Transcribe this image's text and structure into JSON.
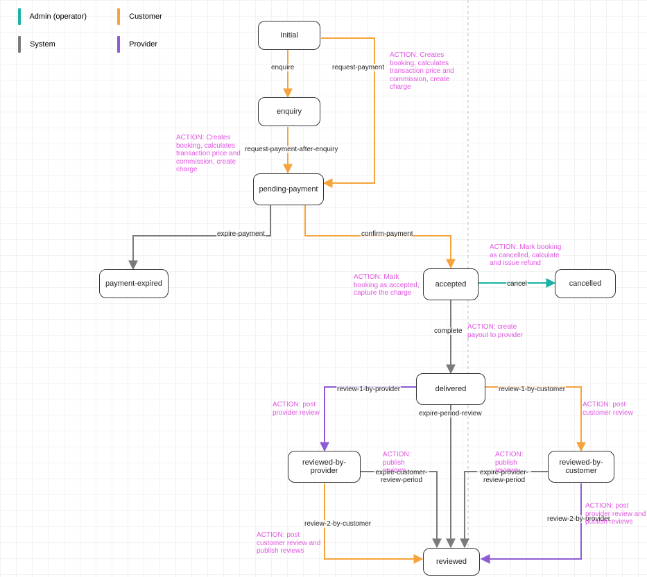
{
  "legend": {
    "admin": "Admin (operator)",
    "customer": "Customer",
    "system": "System",
    "provider": "Provider"
  },
  "colors": {
    "admin": "#18b3a6",
    "customer": "#f6a33b",
    "system": "#7a7a7a",
    "provider": "#8e5bd3",
    "action": "#e157e1"
  },
  "states": {
    "initial": "Initial",
    "enquiry": "enquiry",
    "pending_payment": "pending-payment",
    "payment_expired": "payment-expired",
    "accepted": "accepted",
    "cancelled": "cancelled",
    "delivered": "delivered",
    "reviewed_by_provider": "reviewed-by-provider",
    "reviewed_by_customer": "reviewed-by-customer",
    "reviewed": "reviewed"
  },
  "edges": {
    "enquire": "enquire",
    "request_payment": "request-payment",
    "request_payment_after_enquiry": "request-payment-after-enquiry",
    "expire_payment": "expire-payment",
    "confirm_payment": "confirm-payment",
    "cancel": "cancel",
    "complete": "complete",
    "review1_provider": "review-1-by-provider",
    "review1_customer": "review-1-by-customer",
    "expire_period_review": "expire-period-review",
    "expire_customer_review_period": "expire-customer-review-period",
    "expire_provider_review_period": "expire-provider-review-period",
    "review2_customer": "review-2-by-customer",
    "review2_provider": "review-2-by-provider"
  },
  "actions": {
    "creates_booking": "ACTION: Creates booking, calculates transaction price and commission, create charge",
    "creates_booking2": "ACTION: Creates booking, calculates transaction price and commission, create charge",
    "mark_accepted": "ACTION: Mark booking as accepted, capture the charge",
    "mark_cancelled": "ACTION: Mark booking as cancelled, calculate and issue refund",
    "create_payout": "ACTION: create payout to provider",
    "post_provider_review": "ACTION: post provider review",
    "post_customer_review": "ACTION: post customer review",
    "publish_reviews1": "ACTION: publish reviews",
    "publish_reviews2": "ACTION: publish reviews",
    "post_customer_and_publish": "ACTION: post customer review and publish reviews",
    "post_provider_and_publish": "ACTION: post provider review and publish reviews"
  }
}
